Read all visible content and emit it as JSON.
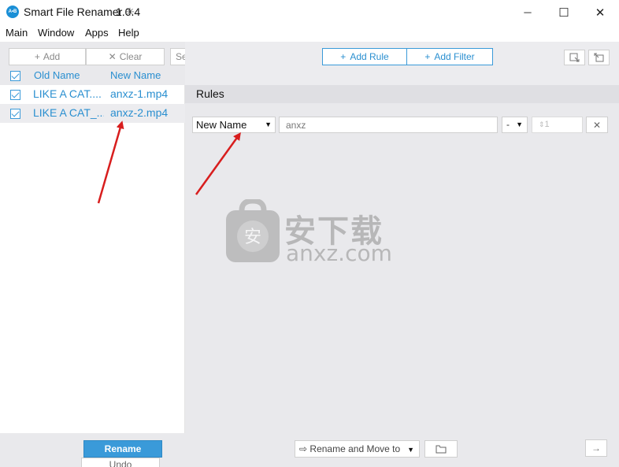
{
  "window": {
    "title": "Smart File Renamer",
    "version_sep": "✳",
    "version": "1.0.4",
    "icon_text": "A•B",
    "minimize": "─",
    "maximize": "☐",
    "close": "✕"
  },
  "menu": [
    "Main",
    "Window",
    "Apps",
    "Help"
  ],
  "file_toolbar": {
    "add_icon": "+",
    "add_label": "Add",
    "clear_icon": "✕",
    "clear_label": "Clear",
    "search_placeholder": "Se"
  },
  "file_list": {
    "columns": [
      "Old Name",
      "New Name"
    ],
    "rows": [
      {
        "old": "LIKE A CAT....",
        "new": "anxz-1.mp4",
        "checked": true
      },
      {
        "old": "LIKE A CAT_...",
        "new": "anxz-2.mp4",
        "checked": true
      }
    ]
  },
  "toolbar": {
    "add_rule_icon": "+",
    "add_rule_label": "Add Rule",
    "add_filter_icon": "+",
    "add_filter_label": "Add Filter"
  },
  "rules": {
    "header": "Rules",
    "items": [
      {
        "type": "New Name",
        "value": "anxz",
        "separator": "-",
        "number": "1",
        "number_icon": "⇕",
        "remove": "✕"
      }
    ]
  },
  "watermark": {
    "cn": "安下载",
    "en": "anxz.com",
    "shield_char": "安"
  },
  "footer": {
    "rename_label": "Rename",
    "undo_label": "Undo",
    "move_icon": "⇨",
    "move_label": "Rename and Move to",
    "next_icon": "→"
  },
  "colors": {
    "accent": "#3a9ad9",
    "annotation": "#d81e1e"
  }
}
